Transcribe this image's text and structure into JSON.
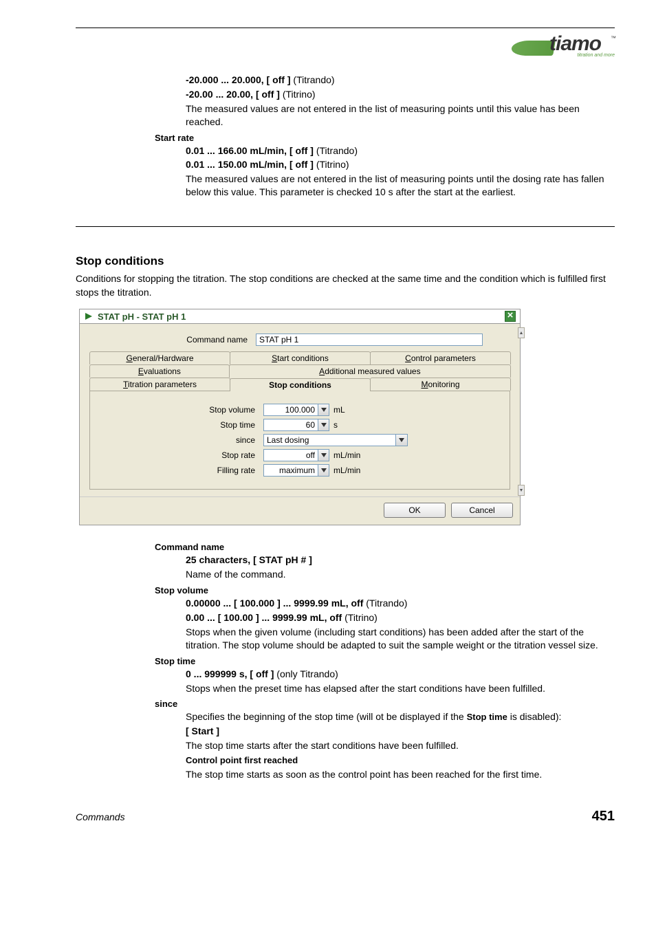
{
  "logo": {
    "text": "tiamo",
    "tm": "™",
    "sub": "titration and more"
  },
  "intro_block": {
    "range1_bold": "-20.000 ... 20.000, [ off ]",
    "range1_tail": " (Titrando)",
    "range2_bold": "-20.00 ... 20.00, [ off ]",
    "range2_tail": " (Titrino)",
    "desc": "The measured values are not entered in the list of measuring points until this value has been reached."
  },
  "start_rate": {
    "name": "Start rate",
    "r1_bold": "0.01 ... 166.00 mL/min, [ off ]",
    "r1_tail": " (Titrando)",
    "r2_bold": "0.01 ... 150.00 mL/min, [ off ]",
    "r2_tail": " (Titrino)",
    "desc": "The measured values are not entered in the list of measuring points until the dosing rate has fallen below this value. This parameter is checked 10 s after the start at the earliest."
  },
  "stop_conditions": {
    "heading": "Stop conditions",
    "intro": "Conditions for stopping the titration. The stop conditions are checked at the same time and the condition which is fulfilled first stops the titration."
  },
  "dialog": {
    "title": "STAT pH - STAT pH 1",
    "command_name_label": "Command name",
    "command_name_value": "STAT pH 1",
    "tabs_row1": [
      "General/Hardware",
      "Start conditions",
      "Control parameters"
    ],
    "tabs_row2": [
      "Evaluations",
      "Additional measured values"
    ],
    "tabs_row3": [
      "Titration parameters",
      "Stop conditions",
      "Monitoring"
    ],
    "active_tab": "Stop conditions",
    "fields": {
      "stop_volume": {
        "label": "Stop volume",
        "value": "100.000",
        "unit": "mL"
      },
      "stop_time": {
        "label": "Stop time",
        "value": "60",
        "unit": "s"
      },
      "since": {
        "label": "since",
        "value": "Last dosing"
      },
      "stop_rate": {
        "label": "Stop rate",
        "value": "off",
        "unit": "mL/min"
      },
      "filling_rate": {
        "label": "Filling rate",
        "value": "maximum",
        "unit": "mL/min"
      }
    },
    "buttons": {
      "ok": "OK",
      "cancel": "Cancel"
    }
  },
  "params": {
    "command_name": {
      "name": "Command name",
      "bold": "25 characters, [ STAT pH # ]",
      "desc": "Name of the command."
    },
    "stop_volume": {
      "name": "Stop volume",
      "b1": "0.00000 ... [ 100.000 ] ... 9999.99 mL, off",
      "t1": " (Titrando)",
      "b2": "0.00 ... [ 100.00 ] ... 9999.99 mL, off",
      "t2": " (Titrino)",
      "desc": "Stops when the given volume (including start conditions) has been added after the start of the titration. The stop volume should be adapted to suit the sample weight or the titration vessel size."
    },
    "stop_time": {
      "name": "Stop time",
      "b1": "0 ... 999999 s, [ off ]",
      "t1": " (only Titrando)",
      "desc": "Stops when the preset time has elapsed after the start conditions have been fulfilled."
    },
    "since": {
      "name": "since",
      "desc_pre": "Specifies the beginning of the stop time (will ot be displayed if the ",
      "desc_bold": "Stop time",
      "desc_post": " is disabled):",
      "opt1_bold": "[ Start ]",
      "opt1_desc": "The stop time starts after the start conditions have been fulfilled.",
      "opt2_bold": "Control point first reached",
      "opt2_desc": "The stop time starts as soon as the control point has been reached for the first time."
    }
  },
  "footer": {
    "left": "Commands",
    "right": "451"
  }
}
